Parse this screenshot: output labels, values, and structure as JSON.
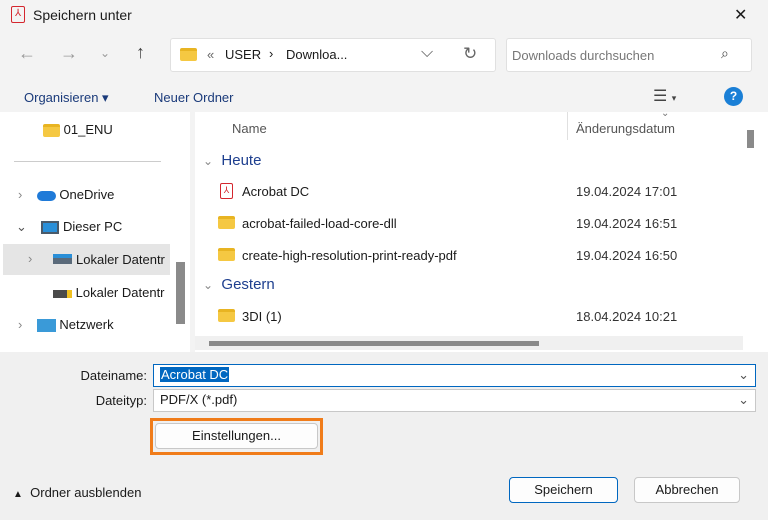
{
  "window": {
    "title": "Speichern unter",
    "close": "✕"
  },
  "nav": {
    "breadcrumb_prefix": "«",
    "crumb1": "USER",
    "sep": "›",
    "crumb2": "Downloa...",
    "search_placeholder": "Downloads durchsuchen"
  },
  "toolbar": {
    "organize": "Organisieren ▾",
    "new_folder": "Neuer Ordner",
    "help": "?"
  },
  "sidebar": {
    "items": [
      {
        "label": "01_ENU"
      },
      {
        "label": "OneDrive"
      },
      {
        "label": "Dieser PC"
      },
      {
        "label": "Lokaler Datentr"
      },
      {
        "label": "Lokaler Datentr"
      },
      {
        "label": "Netzwerk"
      }
    ]
  },
  "filelist": {
    "col_name": "Name",
    "col_date": "Änderungsdatum",
    "groups": [
      {
        "label": "Heute"
      },
      {
        "label": "Gestern"
      }
    ],
    "rows": [
      {
        "name": "Acrobat DC",
        "date": "19.04.2024 17:01"
      },
      {
        "name": "acrobat-failed-load-core-dll",
        "date": "19.04.2024 16:51"
      },
      {
        "name": "create-high-resolution-print-ready-pdf",
        "date": "19.04.2024 16:50"
      },
      {
        "name": "3DI (1)",
        "date": "18.04.2024 10:21"
      }
    ]
  },
  "form": {
    "filename_label": "Dateiname:",
    "filename_value": "Acrobat DC",
    "filetype_label": "Dateityp:",
    "filetype_value": "PDF/X (*.pdf)",
    "settings": "Einstellungen..."
  },
  "footer": {
    "hide_folders": "Ordner ausblenden",
    "save": "Speichern",
    "cancel": "Abbrechen"
  },
  "colors": {
    "highlight": "#f07c1a",
    "accent": "#0067c0"
  }
}
